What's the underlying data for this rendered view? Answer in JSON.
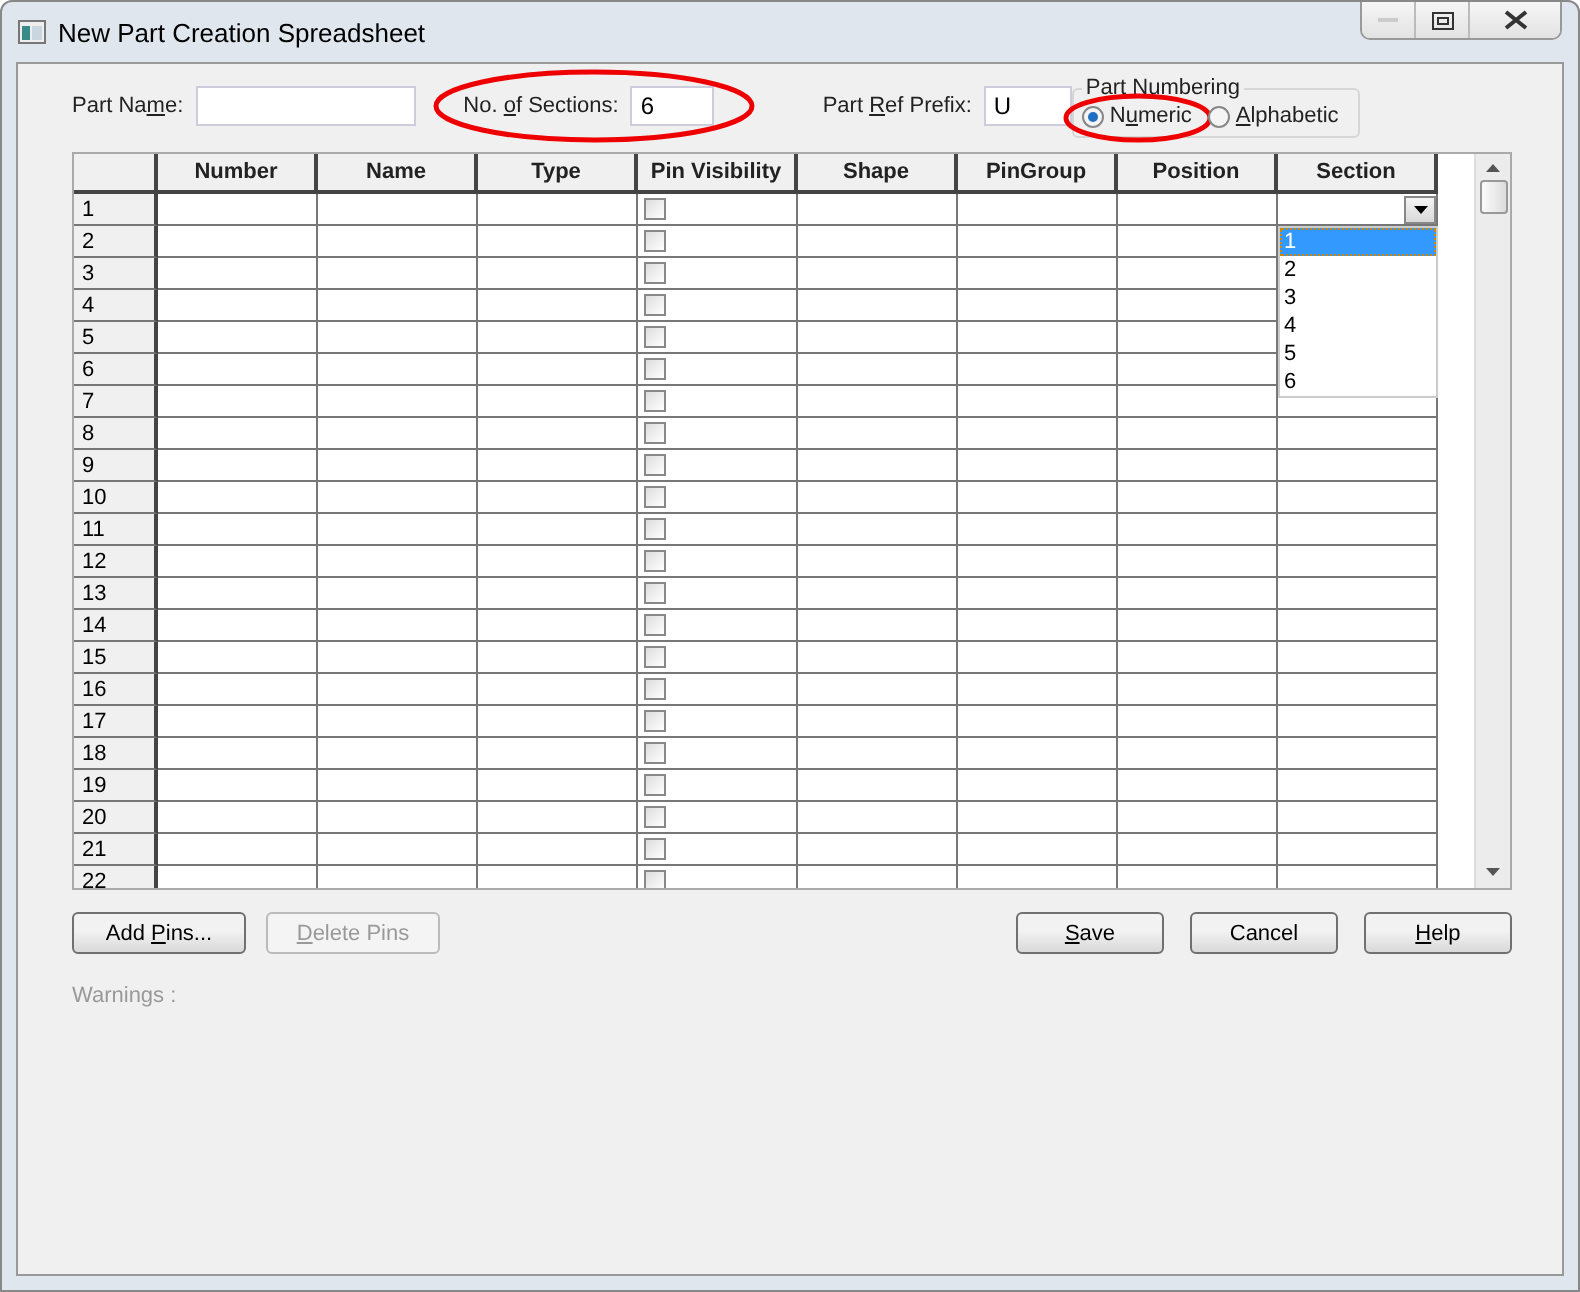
{
  "window": {
    "title": "New Part Creation Spreadsheet"
  },
  "fields": [
    {
      "label": {
        "before": "Part Na",
        "key": "m",
        "after": "e:"
      },
      "highlighted": false
    },
    {
      "label": {
        "before": "No. ",
        "key": "o",
        "after": "f Sections:"
      },
      "value": "6",
      "highlighted": true
    },
    {
      "label": {
        "before": "Part ",
        "key": "R",
        "after": "ef Prefix:"
      },
      "value": "U",
      "highlighted": false
    }
  ],
  "part_numbering": {
    "title": "Part Numbering",
    "options": [
      {
        "label": {
          "before": "N",
          "key": "u",
          "after": "meric"
        },
        "selected": true,
        "highlighted": true
      },
      {
        "label": {
          "key": "A",
          "after": "lphabetic"
        },
        "selected": false,
        "highlighted": false
      }
    ]
  },
  "table": {
    "columns": [
      "Number",
      "Name",
      "Type",
      "Pin Visibility",
      "Shape",
      "PinGroup",
      "Position",
      "Section"
    ],
    "rows": [
      {
        "label": "1",
        "pin_visible": false
      },
      {
        "label": "2",
        "pin_visible": false
      },
      {
        "label": "3",
        "pin_visible": false
      },
      {
        "label": "4",
        "pin_visible": false
      },
      {
        "label": "5",
        "pin_visible": false
      },
      {
        "label": "6",
        "pin_visible": false
      },
      {
        "label": "7",
        "pin_visible": false
      },
      {
        "label": "8",
        "pin_visible": false
      },
      {
        "label": "9",
        "pin_visible": false
      },
      {
        "label": "10",
        "pin_visible": false
      },
      {
        "label": "11",
        "pin_visible": false
      },
      {
        "label": "12",
        "pin_visible": false
      },
      {
        "label": "13",
        "pin_visible": false
      },
      {
        "label": "14",
        "pin_visible": false
      },
      {
        "label": "15",
        "pin_visible": false
      },
      {
        "label": "16",
        "pin_visible": false
      },
      {
        "label": "17",
        "pin_visible": false
      },
      {
        "label": "18",
        "pin_visible": false
      },
      {
        "label": "19",
        "pin_visible": false
      },
      {
        "label": "20",
        "pin_visible": false
      },
      {
        "label": "21",
        "pin_visible": false
      },
      {
        "label": "22",
        "pin_visible": false
      }
    ],
    "section_dropdown": {
      "options": [
        {
          "label": "1",
          "selected": true
        },
        {
          "label": "2",
          "selected": false
        },
        {
          "label": "3",
          "selected": false
        },
        {
          "label": "4",
          "selected": false
        },
        {
          "label": "5",
          "selected": false
        },
        {
          "label": "6",
          "selected": false
        }
      ]
    }
  },
  "left_buttons": [
    {
      "label": {
        "before": "Add ",
        "key": "P",
        "after": "ins..."
      },
      "disabled": false
    },
    {
      "label": {
        "key": "D",
        "after": "elete Pins"
      },
      "disabled": true
    }
  ],
  "right_buttons": [
    {
      "label": {
        "key": "S",
        "after": "ave"
      },
      "disabled": false
    },
    {
      "label": {
        "before": "Cancel"
      },
      "disabled": false
    },
    {
      "label": {
        "key": "H",
        "after": "elp"
      },
      "disabled": false
    }
  ],
  "warnings_label": "Warnings :"
}
